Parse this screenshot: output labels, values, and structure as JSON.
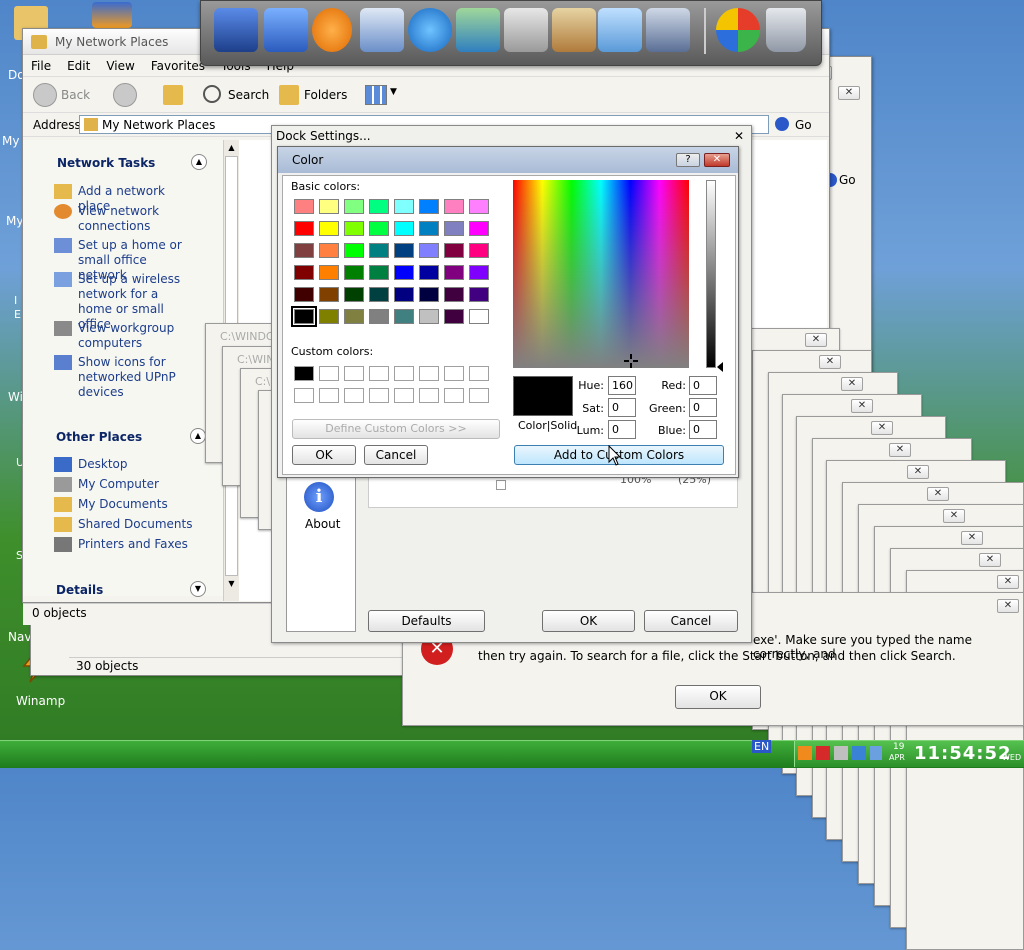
{
  "explorer": {
    "title": "My Network Places",
    "menu": [
      "File",
      "Edit",
      "View",
      "Favorites",
      "Tools",
      "Help"
    ],
    "toolbar": {
      "back": "Back",
      "search": "Search",
      "folders": "Folders"
    },
    "address_label": "Address",
    "address_value": "My Network Places",
    "go": "Go",
    "network_tasks_title": "Network Tasks",
    "network_tasks": [
      "Add a network place",
      "View network connections",
      "Set up a home or small office network",
      "Set up a wireless network for a home or small office",
      "View workgroup computers",
      "Show icons for networked UPnP devices"
    ],
    "other_places_title": "Other Places",
    "other_places": [
      "Desktop",
      "My Computer",
      "My Documents",
      "Shared Documents",
      "Printers and Faxes"
    ],
    "details_title": "Details",
    "status": "0 objects"
  },
  "explorer2": {
    "go": "Go",
    "status": "30 objects"
  },
  "cmd_windows": [
    "C:\\WINDO",
    "C:\\WIN",
    "C:\\"
  ],
  "dock_settings": {
    "title": "Dock Settings...",
    "about": "About",
    "defaults": "Defaults",
    "ok": "OK",
    "cancel": "Cancel",
    "partial_value1": "100%",
    "partial_value2": "(25%)"
  },
  "color_dialog": {
    "title": "Color",
    "help": "?",
    "basic_colors_label": "Basic colors:",
    "custom_colors_label": "Custom colors:",
    "define_custom": "Define Custom Colors >>",
    "ok": "OK",
    "cancel": "Cancel",
    "color_solid": "Color|Solid",
    "hue_label": "Hue:",
    "hue": "160",
    "sat_label": "Sat:",
    "sat": "0",
    "lum_label": "Lum:",
    "lum": "0",
    "red_label": "Red:",
    "red": "0",
    "green_label": "Green:",
    "green": "0",
    "blue_label": "Blue:",
    "blue": "0",
    "add_custom": "Add to Custom Colors",
    "basic_colors": [
      "#ff8080",
      "#ffff80",
      "#80ff80",
      "#00ff80",
      "#80ffff",
      "#0080ff",
      "#ff80c0",
      "#ff80ff",
      "#ff0000",
      "#ffff00",
      "#80ff00",
      "#00ff40",
      "#00ffff",
      "#0080c0",
      "#8080c0",
      "#ff00ff",
      "#804040",
      "#ff8040",
      "#00ff00",
      "#008080",
      "#004080",
      "#8080ff",
      "#800040",
      "#ff0080",
      "#800000",
      "#ff8000",
      "#008000",
      "#008040",
      "#0000ff",
      "#0000a0",
      "#800080",
      "#8000ff",
      "#400000",
      "#804000",
      "#004000",
      "#004040",
      "#000080",
      "#000040",
      "#400040",
      "#400080",
      "#000000",
      "#808000",
      "#808040",
      "#808080",
      "#408080",
      "#c0c0c0",
      "#400040",
      "#ffffff"
    ],
    "custom_colors": [
      "#000000",
      "#ffffff",
      "#ffffff",
      "#ffffff",
      "#ffffff",
      "#ffffff",
      "#ffffff",
      "#ffffff",
      "#ffffff",
      "#ffffff",
      "#ffffff",
      "#ffffff",
      "#ffffff",
      "#ffffff",
      "#ffffff",
      "#ffffff"
    ]
  },
  "error_dialog": {
    "message_line1": "exe'. Make sure you typed the name correctly, and",
    "message_line2": "then try again. To search for a file, click the Start button, and then click Search.",
    "ok": "OK"
  },
  "desktop_icons": {
    "winamp": "Winamp",
    "partial": [
      "Do",
      "My",
      "My",
      "I",
      "E",
      "Win",
      "U",
      "S",
      "Navi"
    ]
  },
  "taskbar": {
    "lang": "EN",
    "date_day": "19",
    "date_month": "APR",
    "time": "11:54:52",
    "weekday": "WED"
  },
  "colors": {
    "xp_blue": "#0a246a",
    "link_blue": "#1d3d8a",
    "error_red": "#d11f1f",
    "taskbar_green": "#2e8a2a"
  }
}
